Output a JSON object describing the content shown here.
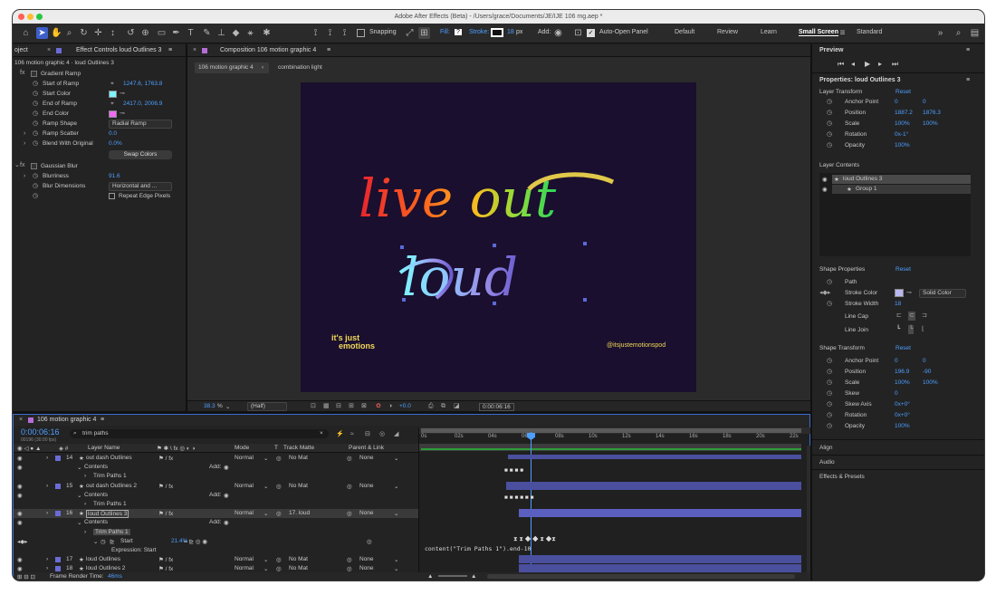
{
  "app": {
    "title": "Adobe After Effects (Beta) - /Users/grace/Documents/JE/IJE 106 mg.aep *"
  },
  "toolbar": {
    "snapping": "Snapping",
    "fill": "Fill:",
    "fill_val": "?",
    "stroke": "Stroke:",
    "stroke_px": "18",
    "stroke_unit": "px",
    "add": "Add:",
    "auto_open": "Auto-Open Panel"
  },
  "workspaces": [
    "Default",
    "Review",
    "Learn",
    "Small Screen",
    "Standard"
  ],
  "left": {
    "tab_project": "oject",
    "tab_effects": "Effect Controls loud Outlines 3",
    "breadcrumb": "106 motion graphic 4 · loud Outlines 3",
    "gradient": {
      "name": "Gradient Ramp",
      "start_ramp_label": "Start of Ramp",
      "start_ramp_val": "1247.6, 1763.8",
      "start_color_label": "Start Color",
      "end_ramp_label": "End of Ramp",
      "end_ramp_val": "2417.0, 2006.9",
      "end_color_label": "End Color",
      "shape_label": "Ramp Shape",
      "shape_val": "Radial Ramp",
      "scatter_label": "Ramp Scatter",
      "scatter_val": "0.0",
      "blend_label": "Blend With Original",
      "blend_val": "0.0%",
      "swap": "Swap Colors"
    },
    "blur": {
      "name": "Gaussian Blur",
      "blur_label": "Blurriness",
      "blur_val": "91.6",
      "dims_label": "Blur Dimensions",
      "dims_val": "Horizontal and ...",
      "repeat": "Repeat Edge Pixels"
    }
  },
  "comp": {
    "tab": "Composition 106 motion graphic 4",
    "flow1": "106 motion graphic 4",
    "flow2": "combination light",
    "art_line1": "live out",
    "art_line2": "loud",
    "logo1": "it's just",
    "logo2": "emotions",
    "handle": "@itsjustemotionspod",
    "zoom": "38.3",
    "zoom_unit": "%",
    "res": "(Half)",
    "exposure": "+0.0",
    "time": "0:00:06:16"
  },
  "right": {
    "preview": "Preview",
    "props_title": "Properties: loud Outlines 3",
    "layer_transform": "Layer Transform",
    "reset": "Reset",
    "lt": [
      {
        "label": "Anchor Point",
        "v1": "0",
        "v2": "0"
      },
      {
        "label": "Position",
        "v1": "1887.2",
        "v2": "1876.3"
      },
      {
        "label": "Scale",
        "v1": "100%",
        "v2": "100%"
      },
      {
        "label": "Rotation",
        "v1": "0x-1°",
        "v2": ""
      },
      {
        "label": "Opacity",
        "v1": "100%",
        "v2": ""
      }
    ],
    "layer_contents": "Layer Contents",
    "lc1": "loud Outlines 3",
    "lc2": "Group 1",
    "shape_props": "Shape Properties",
    "sp": {
      "path": "Path",
      "stroke_color": "Stroke Color",
      "solid": "Solid Color",
      "stroke_width": "Stroke Width",
      "stroke_width_val": "18",
      "cap": "Line Cap",
      "join": "Line Join"
    },
    "shape_transform": "Shape Transform",
    "st": [
      {
        "label": "Anchor Point",
        "v1": "0",
        "v2": "0"
      },
      {
        "label": "Position",
        "v1": "196.9",
        "v2": "-90"
      },
      {
        "label": "Scale",
        "v1": "100%",
        "v2": "100%"
      },
      {
        "label": "Skew",
        "v1": "0",
        "v2": ""
      },
      {
        "label": "Skew Axis",
        "v1": "0x+0°",
        "v2": ""
      },
      {
        "label": "Rotation",
        "v1": "0x+0°",
        "v2": ""
      },
      {
        "label": "Opacity",
        "v1": "100%",
        "v2": ""
      }
    ],
    "align": "Align",
    "audio": "Audio",
    "effects": "Effects & Presets"
  },
  "timeline": {
    "tab": "106 motion graphic 4",
    "time": "0:00:06:16",
    "frames": "00196 (30.00 fps)",
    "search": "trim paths",
    "col_layer": "Layer Name",
    "col_mode": "Mode",
    "col_t": "T",
    "col_matte": "Track Matte",
    "col_parent": "Parent & Link",
    "ticks": [
      "0s",
      "02s",
      "04s",
      "06s",
      "08s",
      "10s",
      "12s",
      "14s",
      "16s",
      "18s",
      "20s",
      "22s"
    ],
    "rows": [
      {
        "kind": "layer",
        "num": "14",
        "name": "out dash Outlines",
        "mode": "Normal",
        "matte": "No Mat",
        "parent": "None"
      },
      {
        "kind": "group",
        "name": "Contents",
        "add": "Add:"
      },
      {
        "kind": "sub",
        "name": "Trim Paths 1"
      },
      {
        "kind": "layer",
        "num": "15",
        "name": "out dash Outlines 2",
        "mode": "Normal",
        "matte": "No Mat",
        "parent": "None"
      },
      {
        "kind": "group",
        "name": "Contents",
        "add": "Add:"
      },
      {
        "kind": "sub",
        "name": "Trim Paths 1"
      },
      {
        "kind": "layer",
        "num": "16",
        "name": "loud Outlines 3",
        "mode": "Normal",
        "matte": "17. loud",
        "parent": "None"
      },
      {
        "kind": "group",
        "name": "Contents",
        "add": "Add:"
      },
      {
        "kind": "sub",
        "name": "Trim Paths 1"
      },
      {
        "kind": "prop",
        "name": "Start",
        "val": "21.4%"
      },
      {
        "kind": "expr",
        "name": "Expression: Start"
      },
      {
        "kind": "layer",
        "num": "17",
        "name": "loud Outlines",
        "mode": "Normal",
        "matte": "No Mat",
        "parent": "None"
      },
      {
        "kind": "layer",
        "num": "18",
        "name": "loud Outlines 2",
        "mode": "Normal",
        "matte": "No Mat",
        "parent": "None"
      }
    ],
    "expression": "content(\"Trim Paths 1\").end-10",
    "render_time_label": "Frame Render Time:",
    "render_time": "46ms"
  },
  "colors": {
    "accent": "#3d5fc9",
    "bar": "#4a4f9e",
    "start_color": "#7ff3ff",
    "end_color": "#f06af0",
    "stroke_color": "#b9b8f0",
    "canvas": "#1a0f2e"
  }
}
